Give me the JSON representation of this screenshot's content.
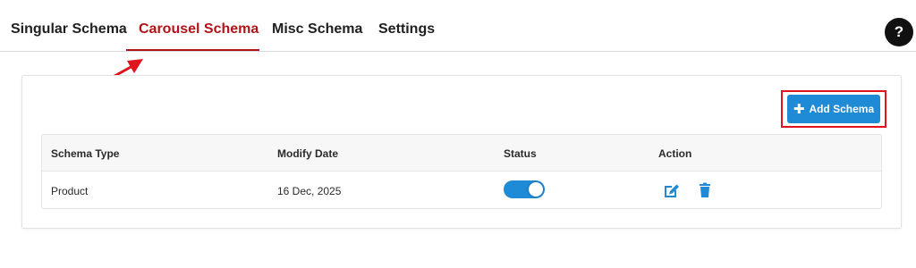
{
  "tabs": [
    {
      "label": "Singular Schema",
      "active": false
    },
    {
      "label": "Carousel Schema",
      "active": true
    },
    {
      "label": "Misc Schema",
      "active": false
    },
    {
      "label": "Settings",
      "active": false
    }
  ],
  "help": {
    "label": "?"
  },
  "toolbar": {
    "add_label": "Add Schema",
    "add_icon": "plus-icon"
  },
  "table": {
    "headers": [
      "Schema Type",
      "Modify Date",
      "Status",
      "Action"
    ],
    "rows": [
      {
        "schema_type": "Product",
        "modify_date": "16 Dec, 2025",
        "status_enabled": true,
        "actions": [
          "edit-icon",
          "trash-icon"
        ]
      }
    ]
  },
  "colors": {
    "accent": "#1f8ad6",
    "active_tab": "#b0141a",
    "annotation": "#e0141c"
  }
}
